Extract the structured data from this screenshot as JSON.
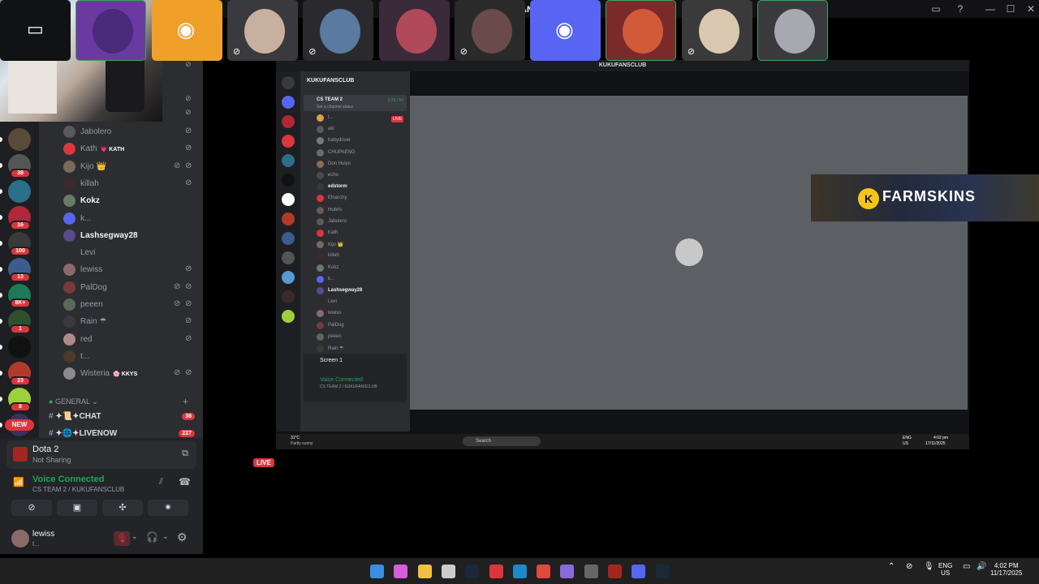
{
  "window": {
    "title": "KUKUFANSCLUB"
  },
  "guild_rail": {
    "items": [
      {
        "icon": "server-1-icon",
        "color": "#5a4a3a",
        "badge": ""
      },
      {
        "icon": "server-2-icon",
        "color": "#555555",
        "badge": "38"
      },
      {
        "icon": "server-3-icon",
        "color": "#2b6f8a",
        "badge": ""
      },
      {
        "icon": "server-4-icon",
        "color": "#b0273a",
        "badge": "16"
      },
      {
        "icon": "server-5-icon",
        "color": "#3a3a3a",
        "badge": "100"
      },
      {
        "icon": "server-6-icon",
        "color": "#3b5c8c",
        "badge": "13"
      },
      {
        "icon": "server-7-icon",
        "color": "#1b7a5a",
        "badge": "8K+"
      },
      {
        "icon": "server-8-icon",
        "color": "#2f4f2f",
        "badge": "1"
      },
      {
        "icon": "server-9-icon",
        "color": "#111111",
        "badge": ""
      },
      {
        "icon": "server-10-icon",
        "color": "#b33a2a",
        "badge": "23"
      },
      {
        "icon": "server-11-icon",
        "color": "#9bd13b",
        "badge": "8"
      },
      {
        "icon": "server-12-icon",
        "color": "#3a3060",
        "badge": ""
      }
    ],
    "new_label": "NEW"
  },
  "voice_users": [
    {
      "name": "Jabolero",
      "bold": false,
      "tag": "",
      "avatar": "#5a5a5a",
      "muted": true,
      "deaf": false
    },
    {
      "name": "Kath",
      "bold": false,
      "tag": "💗 KATH",
      "avatar": "#da373c",
      "muted": true,
      "deaf": false
    },
    {
      "name": "Kijo 👑",
      "bold": false,
      "tag": "",
      "avatar": "#7a6a5a",
      "muted": true,
      "deaf": true
    },
    {
      "name": "killah",
      "bold": false,
      "tag": "",
      "avatar": "#3a2a2a",
      "muted": true,
      "deaf": false
    },
    {
      "name": "Kokz",
      "bold": true,
      "tag": "",
      "avatar": "#6a7a6a",
      "muted": false,
      "deaf": false
    },
    {
      "name": "k...",
      "bold": false,
      "tag": "",
      "avatar": "#5865f2",
      "muted": false,
      "deaf": false
    },
    {
      "name": "Lashsegway28",
      "bold": true,
      "tag": "",
      "avatar": "#5a4a8a",
      "muted": false,
      "deaf": false
    },
    {
      "name": "Levi",
      "bold": false,
      "tag": "",
      "avatar": "#2b2d31",
      "muted": false,
      "deaf": false
    },
    {
      "name": "lewiss",
      "bold": false,
      "tag": "",
      "avatar": "#8a6a6a",
      "muted": true,
      "deaf": false
    },
    {
      "name": "PalDog",
      "bold": false,
      "tag": "",
      "avatar": "#7a3a3a",
      "muted": true,
      "deaf": true
    },
    {
      "name": "peeen",
      "bold": false,
      "tag": "",
      "avatar": "#5a6a5a",
      "muted": true,
      "deaf": true
    },
    {
      "name": "Rain ☂",
      "bold": false,
      "tag": "",
      "avatar": "#3a3a3a",
      "muted": true,
      "deaf": false
    },
    {
      "name": "red",
      "bold": false,
      "tag": "",
      "avatar": "#b08a8a",
      "muted": true,
      "deaf": false
    },
    {
      "name": "t...",
      "bold": false,
      "tag": "",
      "avatar": "#4a3a2a",
      "muted": false,
      "deaf": false
    },
    {
      "name": "Wisteria",
      "bold": false,
      "tag": "🌸 KKYS",
      "avatar": "#8a8a8a",
      "muted": true,
      "deaf": true
    }
  ],
  "category": {
    "label": "GENERAL"
  },
  "text_channels": [
    {
      "label": "✦📜✦CHAT",
      "count": "38"
    },
    {
      "label": "✦🌐✦LIVENOW",
      "count": "227"
    }
  ],
  "activity": {
    "game": "Dota 2",
    "status": "Not Sharing"
  },
  "voice": {
    "status": "Voice Connected",
    "channel": "CS TEAM 2 / KUKUFANSCLUB"
  },
  "user": {
    "name": "lewiss",
    "status": "t..."
  },
  "stream": {
    "title": "KUKUFANSCLUB",
    "server": "KUKUFANSCLUB",
    "channel": "CS TEAM 2",
    "channel_status": "Set a channel status",
    "channel_count": "1/25 / 50",
    "live_label": "LIVE",
    "users": [
      {
        "name": "t...",
        "bold": false,
        "avatar": "#e0a040"
      },
      {
        "name": "aki",
        "bold": false,
        "avatar": "#5a5a5a"
      },
      {
        "name": "babydriver",
        "bold": false,
        "avatar": "#7a7a7a"
      },
      {
        "name": "CHUPAENG",
        "bold": false,
        "avatar": "#6a6a6a"
      },
      {
        "name": "Don Hulyo",
        "bold": false,
        "avatar": "#8a6a5a"
      },
      {
        "name": "echo",
        "bold": false,
        "avatar": "#4a4a4a"
      },
      {
        "name": "edstorm",
        "bold": true,
        "avatar": "#3a3a3a"
      },
      {
        "name": "Elnarchy",
        "bold": false,
        "avatar": "#da373c"
      },
      {
        "name": "Hubris",
        "bold": false,
        "avatar": "#6a5a5a"
      },
      {
        "name": "Jabolero",
        "bold": false,
        "avatar": "#5a5a5a"
      },
      {
        "name": "Kath",
        "bold": false,
        "avatar": "#da373c"
      },
      {
        "name": "Kijo 👑",
        "bold": false,
        "avatar": "#7a6a5a"
      },
      {
        "name": "killah",
        "bold": false,
        "avatar": "#3a2a2a"
      },
      {
        "name": "Kokz",
        "bold": false,
        "avatar": "#6a7a6a"
      },
      {
        "name": "k...",
        "bold": false,
        "avatar": "#5865f2"
      },
      {
        "name": "Lashsegway28",
        "bold": true,
        "avatar": "#5a4a8a"
      },
      {
        "name": "Levi",
        "bold": false,
        "avatar": "#2b2d31"
      },
      {
        "name": "lewiss",
        "bold": false,
        "avatar": "#8a6a6a"
      },
      {
        "name": "PalDog",
        "bold": false,
        "avatar": "#7a3a3a"
      },
      {
        "name": "peeen",
        "bold": false,
        "avatar": "#5a6a5a"
      },
      {
        "name": "Rain ☂",
        "bold": false,
        "avatar": "#3a3a3a"
      }
    ],
    "screen_label": "Screen 1",
    "voice_status": "Voice Connected",
    "voice_channel": "CS TEAM 2 / KUKUFANSCLUB",
    "taskbar": {
      "weather_temp": "31°C",
      "weather_desc": "Partly sunny",
      "search_placeholder": "Search",
      "lang_top": "ENG",
      "lang_bottom": "US",
      "time": "4:02 pm",
      "date": "17/11/2025"
    }
  },
  "ad": {
    "brand": "FARMSKINS"
  },
  "participants": {
    "live_label": "LIVE",
    "tiles": [
      {
        "kind": "screen",
        "bg": "#111214",
        "avatar": "",
        "muted": false,
        "border": "#111214"
      },
      {
        "kind": "avatar",
        "bg": "#6b3aa0",
        "avatar": "#4a2a7a",
        "muted": false,
        "border": "#3ba55d"
      },
      {
        "kind": "discord",
        "bg": "#f0a028",
        "avatar": "",
        "muted": false,
        "border": "#f0a028"
      },
      {
        "kind": "avatar",
        "bg": "#3a3a3e",
        "avatar": "#c8b0a0",
        "muted": true,
        "border": "#3a3a3e"
      },
      {
        "kind": "avatar",
        "bg": "#2a2a2e",
        "avatar": "#5a7aa0",
        "muted": true,
        "border": "#2a2a2e"
      },
      {
        "kind": "avatar",
        "bg": "#3a2a3a",
        "avatar": "#b04a5a",
        "muted": false,
        "border": "#3a2a3a"
      },
      {
        "kind": "avatar",
        "bg": "#2a2a2a",
        "avatar": "#6a4a4a",
        "muted": true,
        "border": "#2a2a2a"
      },
      {
        "kind": "discord",
        "bg": "#5865f2",
        "avatar": "",
        "muted": false,
        "border": "#5865f2"
      },
      {
        "kind": "avatar",
        "bg": "#7a2a2a",
        "avatar": "#d05a3a",
        "muted": false,
        "border": "#3ba55d"
      },
      {
        "kind": "avatar",
        "bg": "#3a3a3a",
        "avatar": "#d8c8b0",
        "muted": true,
        "border": "#3a3a3a"
      },
      {
        "kind": "avatar",
        "bg": "#3a3a3e",
        "avatar": "#a8a8b0",
        "muted": false,
        "border": "#3ba55d"
      }
    ]
  },
  "taskbar": {
    "lang_top": "ENG",
    "lang_bottom": "US",
    "time": "4:02 PM",
    "date": "11/17/2025"
  },
  "colors": {
    "accent_red": "#da373c",
    "voice_green": "#23a55a",
    "blurple": "#5865f2"
  }
}
